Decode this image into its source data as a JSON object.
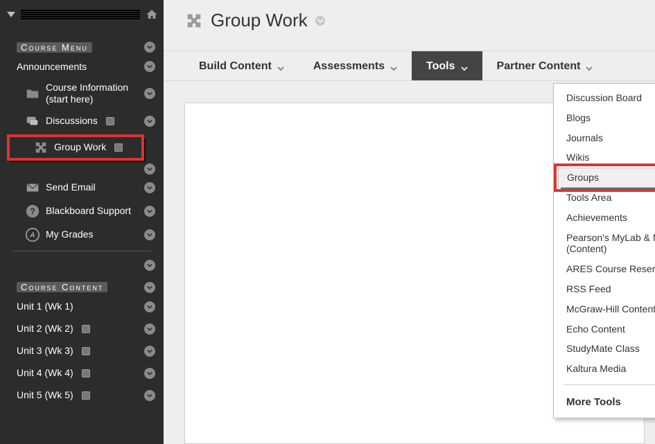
{
  "sidebar": {
    "section_menu": "Course Menu",
    "section_content": "Course Content",
    "items": [
      {
        "label": "Announcements",
        "icon": null
      },
      {
        "label": "Course Information (start here)",
        "icon": "folder"
      },
      {
        "label": "Discussions",
        "icon": "discuss",
        "badge": true
      },
      {
        "label": "Group Work",
        "icon": "puzzle",
        "selected": true,
        "badge": true
      },
      {
        "label": "Send Email",
        "icon": "mail"
      },
      {
        "label": "Blackboard Support",
        "icon": "help"
      },
      {
        "label": "My Grades",
        "icon": "grades"
      }
    ],
    "content_items": [
      {
        "label": "Unit 1 (Wk 1)"
      },
      {
        "label": "Unit 2 (Wk 2)",
        "badge": true
      },
      {
        "label": "Unit 3 (Wk 3)",
        "badge": true
      },
      {
        "label": "Unit 4 (Wk 4)",
        "badge": true
      },
      {
        "label": "Unit 5 (Wk 5)",
        "badge": true
      }
    ]
  },
  "page": {
    "title": "Group Work"
  },
  "actionbar": {
    "build": "Build Content",
    "assess": "Assessments",
    "tools": "Tools",
    "partner": "Partner Content"
  },
  "tools_menu": {
    "items": [
      "Discussion Board",
      "Blogs",
      "Journals",
      "Wikis",
      "Groups",
      "Tools Area",
      "Achievements",
      "Pearson's MyLab & Mastering (Content)",
      "ARES Course Reserves",
      "RSS Feed",
      "McGraw-Hill Content",
      "Echo Content",
      "StudyMate Class",
      "Kaltura Media"
    ],
    "highlight_index": 4,
    "more": "More Tools"
  }
}
